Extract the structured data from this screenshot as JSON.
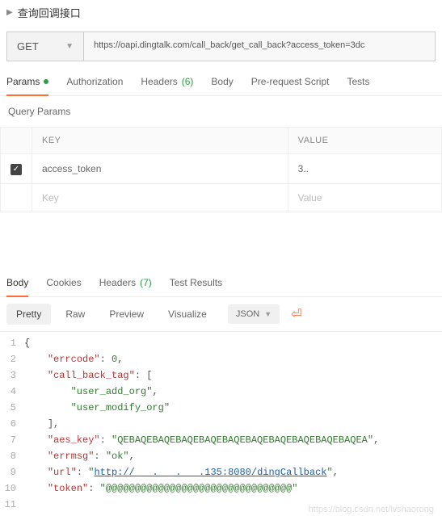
{
  "header": {
    "title": "查询回调接口"
  },
  "request": {
    "method": "GET",
    "url": "https://oapi.dingtalk.com/call_back/get_call_back?access_token=3dc"
  },
  "reqTabs": [
    {
      "label": "Params",
      "active": true,
      "dot": true
    },
    {
      "label": "Authorization"
    },
    {
      "label": "Headers",
      "count": "(6)"
    },
    {
      "label": "Body"
    },
    {
      "label": "Pre-request Script"
    },
    {
      "label": "Tests"
    }
  ],
  "queryParams": {
    "title": "Query Params",
    "headers": {
      "key": "KEY",
      "value": "VALUE"
    },
    "rows": [
      {
        "checked": true,
        "key": "access_token",
        "value": "3.."
      }
    ],
    "placeholder": {
      "key": "Key",
      "value": "Value"
    }
  },
  "respTabs": [
    {
      "label": "Body",
      "active": true
    },
    {
      "label": "Cookies"
    },
    {
      "label": "Headers",
      "count": "(7)"
    },
    {
      "label": "Test Results"
    }
  ],
  "bodyBar": {
    "views": [
      "Pretty",
      "Raw",
      "Preview",
      "Visualize"
    ],
    "selected": "Pretty",
    "type": "JSON"
  },
  "responseJson": {
    "errcode": 0,
    "call_back_tag": [
      "user_add_org",
      "user_modify_org"
    ],
    "aes_key": "QEBAQEBAQEBAQEBAQEBAQEBAQEBAQEBAQEBAQEBAQEA",
    "errmsg": "ok",
    "url": "http://   .   .   .135:8080/dingCallback",
    "token": "@@@@@@@@@@@@@@@@@@@@@@@@@@@@@@@@"
  },
  "watermark": "https://blog.csdn.net/lvshaorong"
}
